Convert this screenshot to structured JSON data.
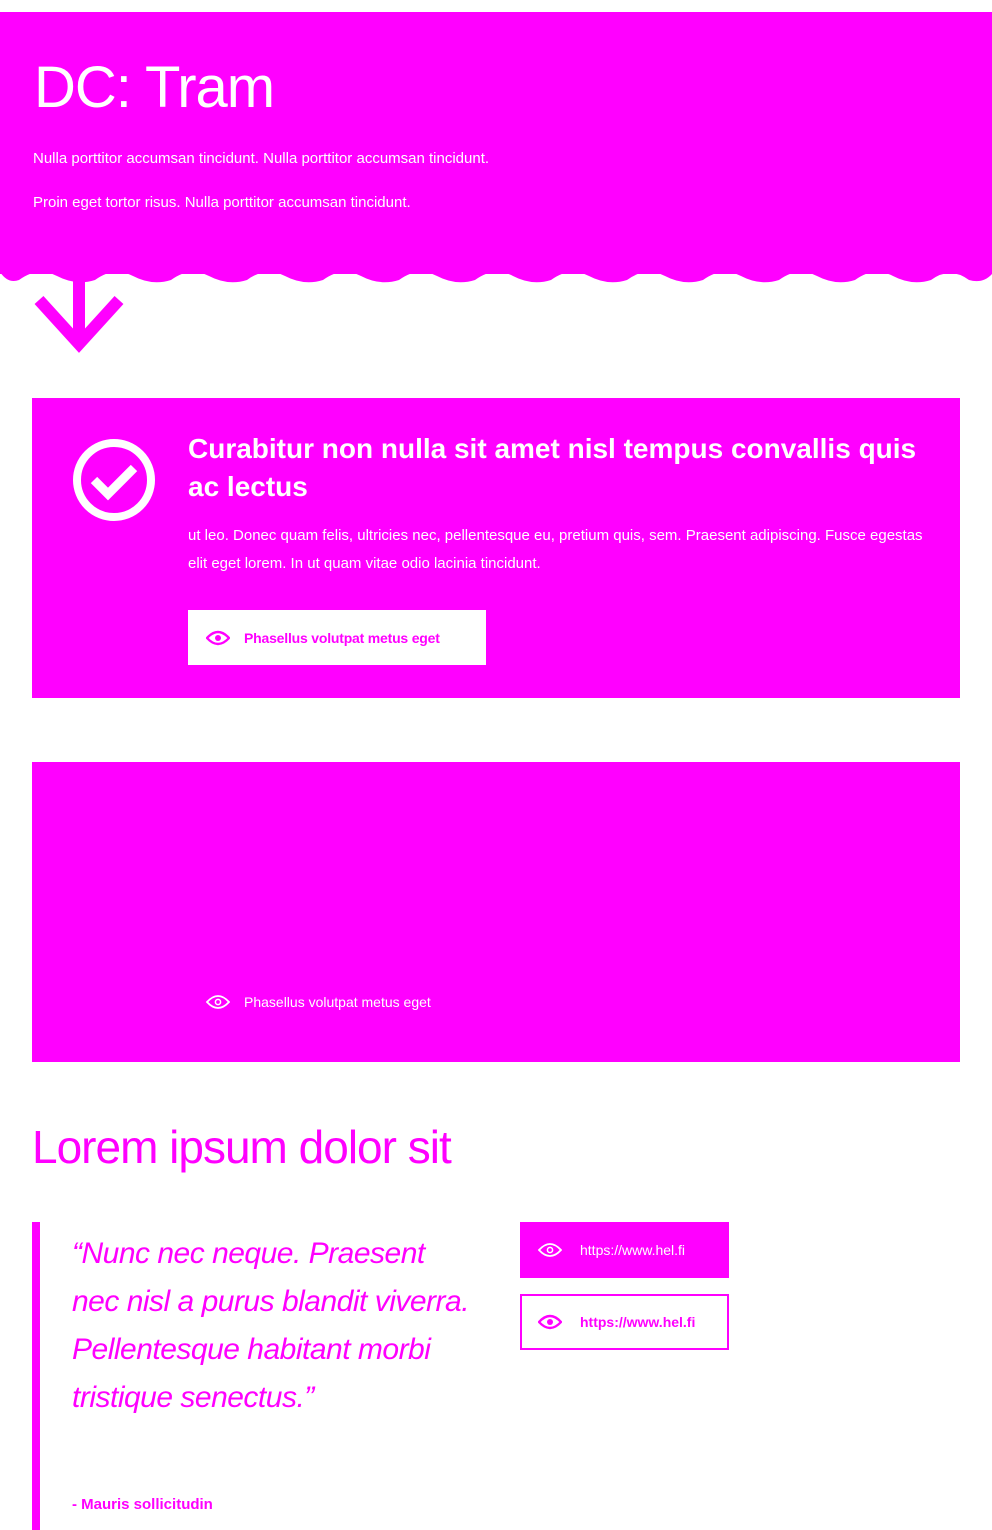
{
  "hero": {
    "title": "DC: Tram",
    "paragraph_1": "Nulla porttitor accumsan tincidunt. Nulla porttitor accumsan tincidunt.",
    "paragraph_2": "Proin eget tortor risus. Nulla porttitor accumsan tincidunt.",
    "arrow_icon": "arrow-down-icon"
  },
  "card_1": {
    "icon": "check-circle-icon",
    "title": "Curabitur non nulla sit amet nisl tempus convallis quis ac lectus",
    "text": "ut leo. Donec quam felis, ultricies nec, pellentesque eu, pretium quis, sem. Praesent adipiscing. Fusce egestas elit eget lorem. In ut quam vitae odio lacinia tincidunt.",
    "button_label": "Phasellus volutpat metus eget",
    "button_icon": "eye-icon"
  },
  "card_2": {
    "button_label": "Phasellus volutpat metus eget",
    "button_icon": "eye-icon"
  },
  "section": {
    "title": "Lorem ipsum dolor sit"
  },
  "quote": {
    "text": "“Nunc nec neque. Praesent nec nisl a purus blandit viverra. Pellentesque habitant morbi tristique senectus.”",
    "author": "- Mauris sollicitudin"
  },
  "links": {
    "filled_label": "https://www.hel.fi",
    "outline_label": "https://www.hel.fi"
  },
  "colors": {
    "accent": "#ff00ff",
    "background": "#ffffff",
    "on_accent": "#ffffff"
  }
}
